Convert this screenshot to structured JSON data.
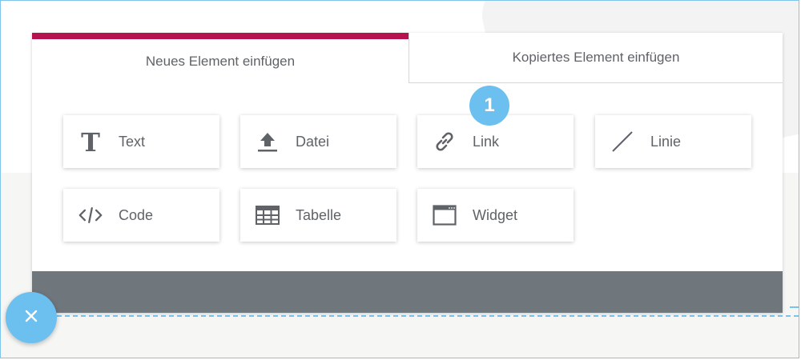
{
  "tabs": [
    {
      "label": "Neues Element einfügen",
      "active": true
    },
    {
      "label": "Kopiertes Element einfügen",
      "active": false
    }
  ],
  "elements": [
    {
      "label": "Text",
      "icon": "text-icon"
    },
    {
      "label": "Datei",
      "icon": "upload-icon"
    },
    {
      "label": "Link",
      "icon": "link-icon"
    },
    {
      "label": "Linie",
      "icon": "line-icon"
    },
    {
      "label": "Code",
      "icon": "code-icon"
    },
    {
      "label": "Tabelle",
      "icon": "table-icon"
    },
    {
      "label": "Widget",
      "icon": "widget-icon"
    }
  ],
  "badge": {
    "number": "1"
  },
  "colors": {
    "accent": "#b5124f",
    "badge": "#6cc0f0",
    "footer": "#6f767c",
    "text": "#5f6368"
  },
  "close_button": {
    "icon": "close-icon"
  }
}
